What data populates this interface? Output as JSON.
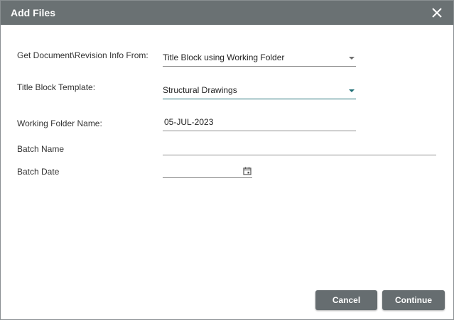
{
  "dialog": {
    "title": "Add Files",
    "close_icon": "close-icon"
  },
  "form": {
    "source": {
      "label": "Get Document\\Revision Info From:",
      "value": "Title Block using Working Folder"
    },
    "template": {
      "label": "Title Block Template:",
      "value": "Structural Drawings"
    },
    "working_folder": {
      "label": "Working Folder Name:",
      "value": "05-JUL-2023"
    },
    "batch_name": {
      "label": "Batch Name",
      "value": ""
    },
    "batch_date": {
      "label": "Batch Date",
      "value": "",
      "icon": "calendar-icon"
    }
  },
  "buttons": {
    "cancel": "Cancel",
    "continue": "Continue"
  },
  "colors": {
    "titlebar": "#6a7173",
    "accent": "#1f6e75",
    "button": "#666d70"
  }
}
